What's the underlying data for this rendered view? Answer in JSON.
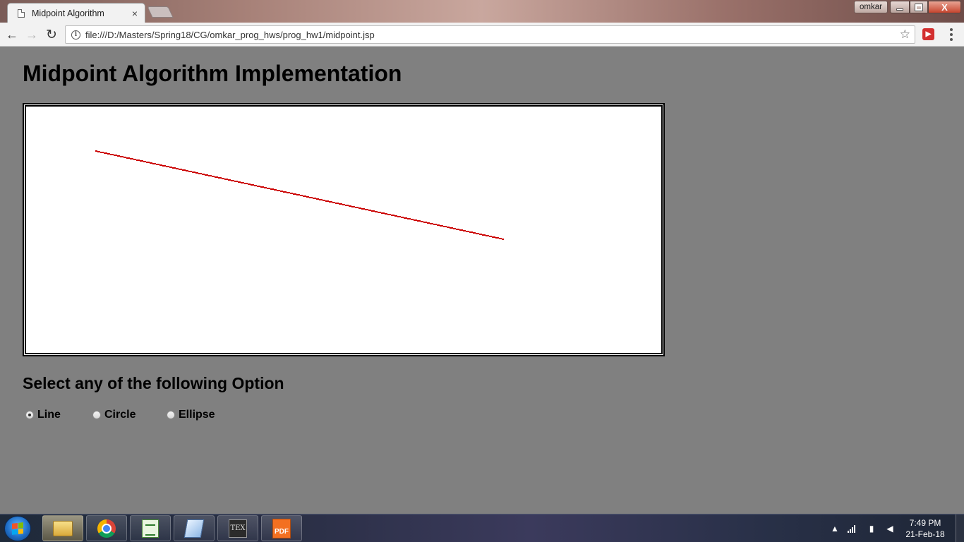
{
  "browser": {
    "tab_title": "Midpoint Algorithm",
    "tab_close": "×",
    "profile_name": "omkar",
    "url": "file:///D:/Masters/Spring18/CG/omkar_prog_hws/prog_hw1/midpoint.jsp",
    "nav": {
      "back": "←",
      "forward": "→",
      "reload": "↻"
    },
    "star": "☆",
    "info": "i",
    "close_glyph": "X"
  },
  "page": {
    "heading": "Midpoint Algorithm Implementation",
    "options_heading": "Select any of the following Option",
    "options": [
      {
        "label": "Line",
        "checked": true
      },
      {
        "label": "Circle",
        "checked": false
      },
      {
        "label": "Ellipse",
        "checked": false
      }
    ]
  },
  "drawing": {
    "stroke_color": "#cc0000",
    "line_start": [
      98,
      62
    ],
    "line_end": [
      676,
      187
    ]
  },
  "taskbar": {
    "apps": [
      "windows-explorer",
      "google-chrome",
      "notepad-plus-plus",
      "documents",
      "texmaker",
      "foxit-pdf"
    ],
    "texmaker_label": "TEX",
    "pdf_label": "PDF",
    "clock_time": "7:49 PM",
    "clock_date": "21-Feb-18"
  }
}
